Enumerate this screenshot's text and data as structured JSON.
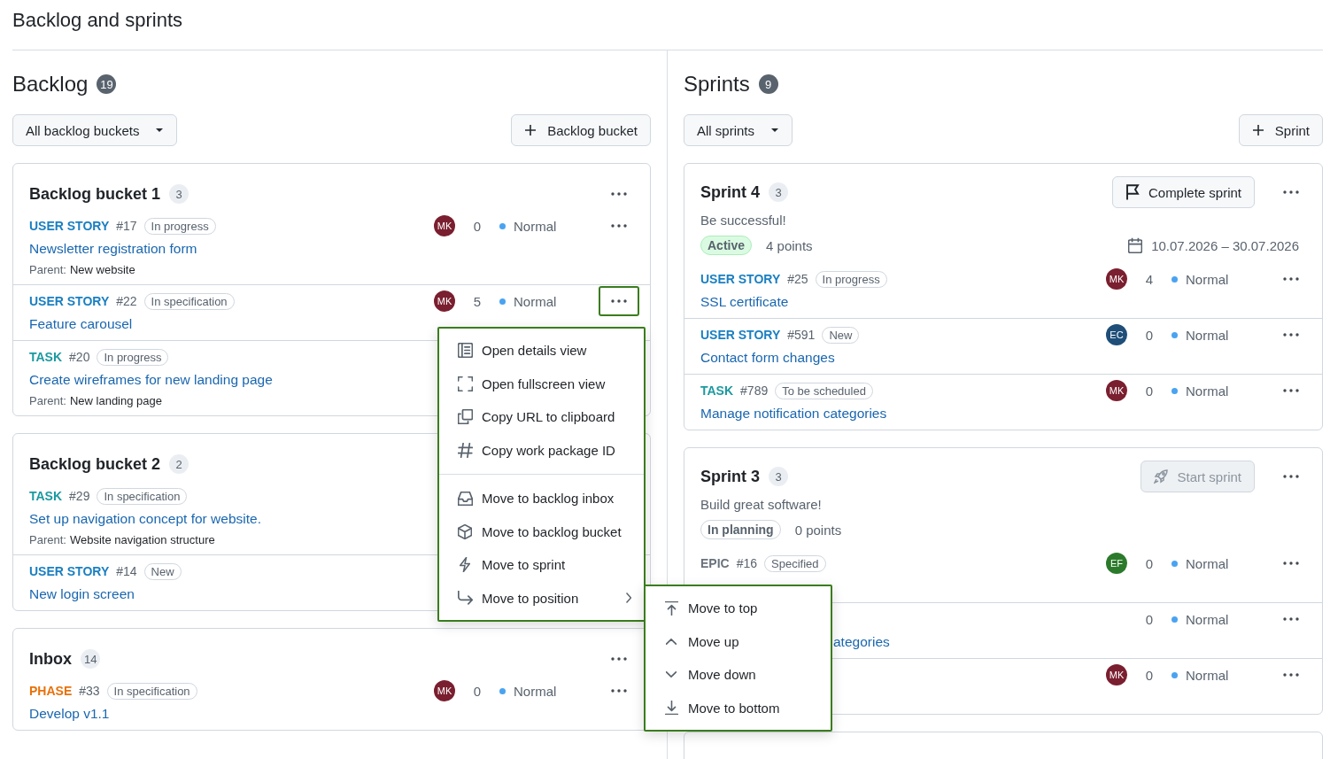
{
  "page_title": "Backlog and sprints",
  "backlog": {
    "title": "Backlog",
    "count": "19",
    "filter": "All backlog buckets",
    "add_button": "Backlog bucket",
    "buckets": [
      {
        "title": "Backlog bucket 1",
        "count": "3",
        "actions": true,
        "items": [
          {
            "kind": "full",
            "type": "USER STORY",
            "color": "#1a7fc1",
            "number": "#17",
            "status": "In progress",
            "assignee": {
              "initials": "MK",
              "color": "#7a1f2f"
            },
            "points": "0",
            "priority": "Normal",
            "actions": true,
            "menu_open": false,
            "title": "Newsletter registration form",
            "parent_label": "Parent:",
            "parent": "New website"
          },
          {
            "kind": "full",
            "type": "USER STORY",
            "color": "#1a7fc1",
            "number": "#22",
            "status": "In specification",
            "assignee": {
              "initials": "MK",
              "color": "#7a1f2f"
            },
            "points": "5",
            "priority": "Normal",
            "actions": true,
            "menu_open": true,
            "title": "Feature carousel"
          },
          {
            "kind": "full",
            "type": "TASK",
            "color": "#1b9aa0",
            "number": "#20",
            "status": "In progress",
            "actions": false,
            "title": "Create wireframes for new landing page",
            "parent_label": "Parent:",
            "parent": "New landing page"
          }
        ]
      },
      {
        "title": "Backlog bucket 2",
        "count": "2",
        "actions": false,
        "items": [
          {
            "kind": "full",
            "type": "TASK",
            "color": "#1b9aa0",
            "number": "#29",
            "status": "In specification",
            "actions": false,
            "title": "Set up navigation concept for website.",
            "parent_label": "Parent:",
            "parent": "Website navigation structure"
          },
          {
            "kind": "full",
            "type": "USER STORY",
            "color": "#1a7fc1",
            "number": "#14",
            "status": "New",
            "actions": false,
            "title": "New login screen"
          }
        ]
      },
      {
        "title": "Inbox",
        "count": "14",
        "actions": true,
        "items": [
          {
            "kind": "full",
            "type": "PHASE",
            "color": "#e8710a",
            "number": "#33",
            "status": "In specification",
            "assignee": {
              "initials": "MK",
              "color": "#7a1f2f"
            },
            "points": "0",
            "priority": "Normal",
            "actions": true,
            "menu_open": false,
            "title": "Develop v1.1"
          }
        ]
      }
    ]
  },
  "sprints": {
    "title": "Sprints",
    "count": "9",
    "filter": "All sprints",
    "add_button": "Sprint",
    "more_below": true,
    "list": [
      {
        "title": "Sprint 4",
        "count": "3",
        "button": {
          "kind": "complete",
          "label": "Complete sprint",
          "disabled": false
        },
        "actions": true,
        "description": "Be successful!",
        "status": {
          "kind": "active",
          "label": "Active"
        },
        "points": "4 points",
        "dates": "10.07.2026 – 30.07.2026",
        "items": [
          {
            "kind": "full",
            "type": "USER STORY",
            "color": "#1a7fc1",
            "number": "#25",
            "status": "In progress",
            "assignee": {
              "initials": "MK",
              "color": "#7a1f2f"
            },
            "points": "4",
            "priority": "Normal",
            "actions": true,
            "menu_open": false,
            "title": "SSL certificate"
          },
          {
            "kind": "full",
            "type": "USER STORY",
            "color": "#1a7fc1",
            "number": "#591",
            "status": "New",
            "assignee": {
              "initials": "EC",
              "color": "#1f4e79"
            },
            "points": "0",
            "priority": "Normal",
            "actions": true,
            "menu_open": false,
            "title": "Contact form changes"
          },
          {
            "kind": "full",
            "type": "TASK",
            "color": "#1b9aa0",
            "number": "#789",
            "status": "To be scheduled",
            "assignee": {
              "initials": "MK",
              "color": "#7a1f2f"
            },
            "points": "0",
            "priority": "Normal",
            "actions": true,
            "menu_open": false,
            "title": "Manage notification categories"
          }
        ]
      },
      {
        "title": "Sprint 3",
        "count": "3",
        "button": {
          "kind": "start",
          "label": "Start sprint",
          "disabled": true
        },
        "actions": true,
        "description": "Build great software!",
        "status": {
          "kind": "planning",
          "label": "In planning"
        },
        "points": "0 points",
        "items": [
          {
            "kind": "full",
            "type": "EPIC",
            "color": "#6a737d",
            "number": "#16",
            "status": "Specified",
            "assignee": {
              "initials": "EF",
              "color": "#2b7a2b"
            },
            "points": "0",
            "priority": "Normal",
            "actions": true,
            "menu_open": false
          },
          {
            "kind": "covered",
            "points": "0",
            "priority": "Normal",
            "actions": true,
            "menu_open": false,
            "title": "ategories"
          },
          {
            "kind": "covered",
            "assignee": {
              "initials": "MK",
              "color": "#7a1f2f"
            },
            "points": "0",
            "priority": "Normal",
            "actions": true,
            "menu_open": false
          }
        ]
      }
    ]
  },
  "context_menu": {
    "groups": [
      [
        {
          "label": "Open details view"
        },
        {
          "label": "Open fullscreen view"
        },
        {
          "label": "Copy URL to clipboard"
        },
        {
          "label": "Copy work package ID"
        }
      ],
      [
        {
          "label": "Move to backlog inbox"
        },
        {
          "label": "Move to backlog bucket"
        },
        {
          "label": "Move to sprint"
        },
        {
          "label": "Move to position",
          "submenu": true
        }
      ]
    ]
  },
  "submenu": {
    "items": [
      {
        "label": "Move to top"
      },
      {
        "label": "Move up"
      },
      {
        "label": "Move down"
      },
      {
        "label": "Move to bottom"
      }
    ]
  }
}
